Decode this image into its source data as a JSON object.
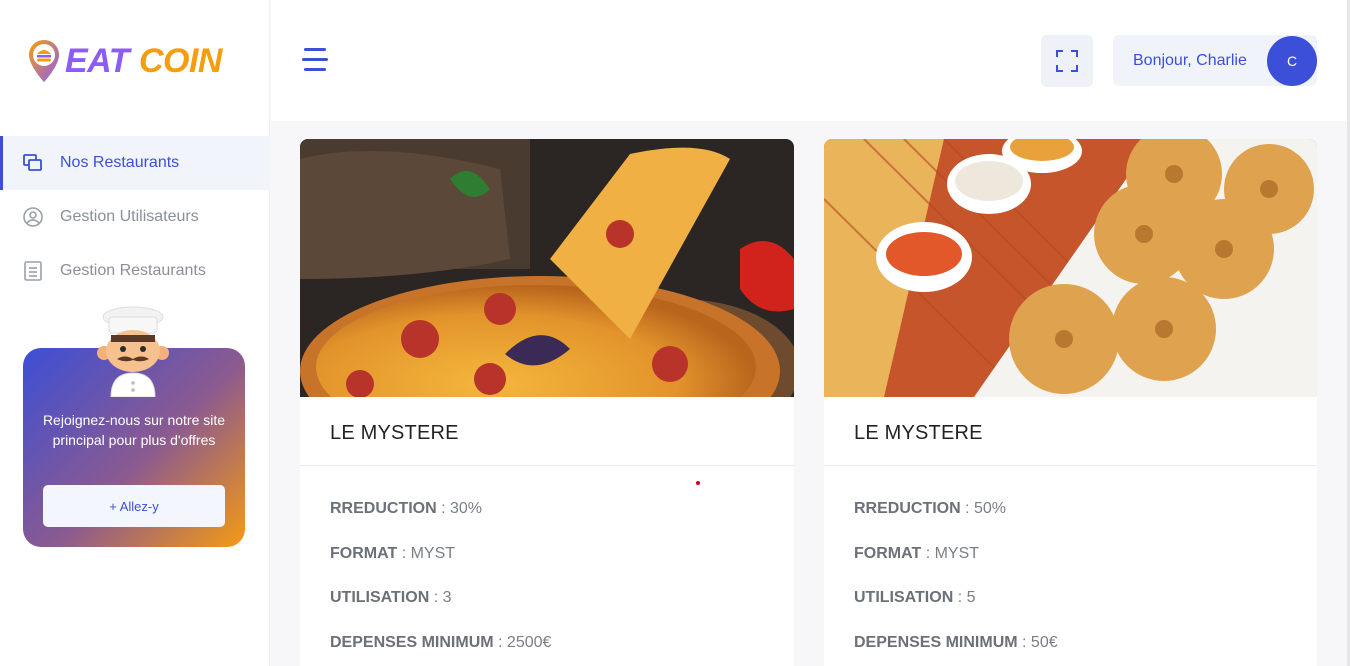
{
  "brand": {
    "word1": "EAT",
    "word2": "COIN",
    "color_primary": "#8b5cf6",
    "color_secondary": "#f59e0b"
  },
  "sidebar": {
    "items": [
      {
        "label": "Nos Restaurants",
        "icon": "windows-icon",
        "active": true
      },
      {
        "label": "Gestion Utilisateurs",
        "icon": "users-circle-icon",
        "active": false
      },
      {
        "label": "Gestion Restaurants",
        "icon": "document-list-icon",
        "active": false
      }
    ],
    "promo": {
      "text": "Rejoignez-nous sur notre site principal pour plus d'offres",
      "button": "+ Allez-y"
    }
  },
  "header": {
    "menu_icon": "hamburger-icon",
    "fullscreen_icon": "fullscreen-icon",
    "greeting": "Bonjour, Charlie",
    "avatar_initial": "C"
  },
  "colors": {
    "accent": "#3b4fd8"
  },
  "cards": [
    {
      "title": "LE MYSTERE",
      "image": "pizza-photo",
      "reduction_label": "RREDUCTION",
      "reduction_value": " : 30%",
      "format_label": "FORMAT",
      "format_value": " : MYST",
      "utilisation_label": "UTILISATION",
      "utilisation_value": " : 3",
      "depenses_label": "DEPENSES MINIMUM",
      "depenses_value": " : 2500€"
    },
    {
      "title": "LE MYSTERE",
      "image": "fried-donuts-photo",
      "reduction_label": "RREDUCTION",
      "reduction_value": " : 50%",
      "format_label": "FORMAT",
      "format_value": " : MYST",
      "utilisation_label": "UTILISATION",
      "utilisation_value": " : 5",
      "depenses_label": "DEPENSES MINIMUM",
      "depenses_value": " : 50€"
    }
  ]
}
